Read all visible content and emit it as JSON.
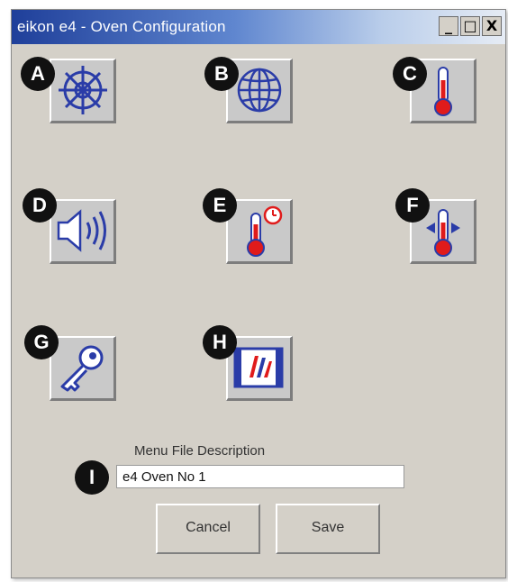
{
  "window": {
    "title": "eikon e4 - Oven Configuration"
  },
  "titlebar_buttons": {
    "minimize": "_",
    "maximize": "□",
    "close": "X"
  },
  "badges": [
    "A",
    "B",
    "C",
    "D",
    "E",
    "F",
    "G",
    "H",
    "I"
  ],
  "icons": {
    "A": "ships-wheel-icon",
    "B": "globe-icon",
    "C": "thermometer-icon",
    "D": "speaker-icon",
    "E": "thermometer-clock-icon",
    "F": "thermometer-arrows-icon",
    "G": "key-icon",
    "H": "logo-screen-icon"
  },
  "form": {
    "description_label": "Menu File Description",
    "description_value": "e4 Oven No 1"
  },
  "actions": {
    "cancel": "Cancel",
    "save": "Save"
  },
  "colors": {
    "icon_blue": "#2a3ca8",
    "thermo_red": "#e01b1b",
    "badge_black": "#111111",
    "dialog_gray": "#d4d0c8"
  }
}
